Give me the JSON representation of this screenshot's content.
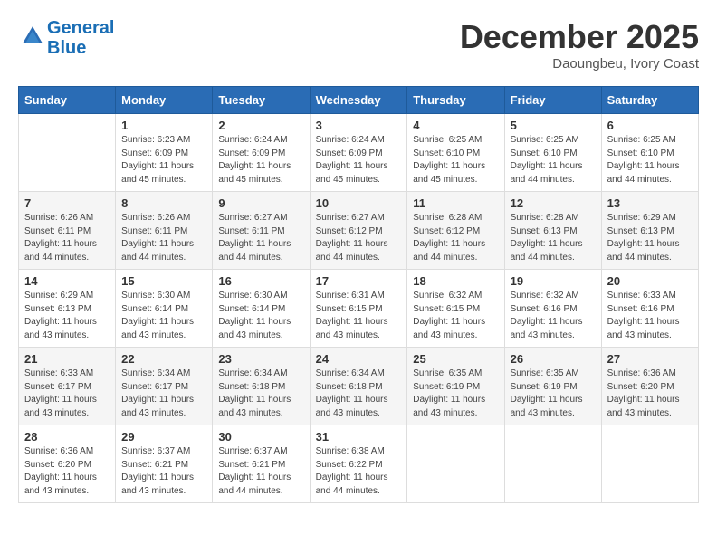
{
  "logo": {
    "line1": "General",
    "line2": "Blue"
  },
  "title": "December 2025",
  "location": "Daoungbeu, Ivory Coast",
  "weekdays": [
    "Sunday",
    "Monday",
    "Tuesday",
    "Wednesday",
    "Thursday",
    "Friday",
    "Saturday"
  ],
  "weeks": [
    [
      {
        "day": "",
        "info": ""
      },
      {
        "day": "1",
        "info": "Sunrise: 6:23 AM\nSunset: 6:09 PM\nDaylight: 11 hours\nand 45 minutes."
      },
      {
        "day": "2",
        "info": "Sunrise: 6:24 AM\nSunset: 6:09 PM\nDaylight: 11 hours\nand 45 minutes."
      },
      {
        "day": "3",
        "info": "Sunrise: 6:24 AM\nSunset: 6:09 PM\nDaylight: 11 hours\nand 45 minutes."
      },
      {
        "day": "4",
        "info": "Sunrise: 6:25 AM\nSunset: 6:10 PM\nDaylight: 11 hours\nand 45 minutes."
      },
      {
        "day": "5",
        "info": "Sunrise: 6:25 AM\nSunset: 6:10 PM\nDaylight: 11 hours\nand 44 minutes."
      },
      {
        "day": "6",
        "info": "Sunrise: 6:25 AM\nSunset: 6:10 PM\nDaylight: 11 hours\nand 44 minutes."
      }
    ],
    [
      {
        "day": "7",
        "info": "Sunrise: 6:26 AM\nSunset: 6:11 PM\nDaylight: 11 hours\nand 44 minutes."
      },
      {
        "day": "8",
        "info": "Sunrise: 6:26 AM\nSunset: 6:11 PM\nDaylight: 11 hours\nand 44 minutes."
      },
      {
        "day": "9",
        "info": "Sunrise: 6:27 AM\nSunset: 6:11 PM\nDaylight: 11 hours\nand 44 minutes."
      },
      {
        "day": "10",
        "info": "Sunrise: 6:27 AM\nSunset: 6:12 PM\nDaylight: 11 hours\nand 44 minutes."
      },
      {
        "day": "11",
        "info": "Sunrise: 6:28 AM\nSunset: 6:12 PM\nDaylight: 11 hours\nand 44 minutes."
      },
      {
        "day": "12",
        "info": "Sunrise: 6:28 AM\nSunset: 6:13 PM\nDaylight: 11 hours\nand 44 minutes."
      },
      {
        "day": "13",
        "info": "Sunrise: 6:29 AM\nSunset: 6:13 PM\nDaylight: 11 hours\nand 44 minutes."
      }
    ],
    [
      {
        "day": "14",
        "info": "Sunrise: 6:29 AM\nSunset: 6:13 PM\nDaylight: 11 hours\nand 43 minutes."
      },
      {
        "day": "15",
        "info": "Sunrise: 6:30 AM\nSunset: 6:14 PM\nDaylight: 11 hours\nand 43 minutes."
      },
      {
        "day": "16",
        "info": "Sunrise: 6:30 AM\nSunset: 6:14 PM\nDaylight: 11 hours\nand 43 minutes."
      },
      {
        "day": "17",
        "info": "Sunrise: 6:31 AM\nSunset: 6:15 PM\nDaylight: 11 hours\nand 43 minutes."
      },
      {
        "day": "18",
        "info": "Sunrise: 6:32 AM\nSunset: 6:15 PM\nDaylight: 11 hours\nand 43 minutes."
      },
      {
        "day": "19",
        "info": "Sunrise: 6:32 AM\nSunset: 6:16 PM\nDaylight: 11 hours\nand 43 minutes."
      },
      {
        "day": "20",
        "info": "Sunrise: 6:33 AM\nSunset: 6:16 PM\nDaylight: 11 hours\nand 43 minutes."
      }
    ],
    [
      {
        "day": "21",
        "info": "Sunrise: 6:33 AM\nSunset: 6:17 PM\nDaylight: 11 hours\nand 43 minutes."
      },
      {
        "day": "22",
        "info": "Sunrise: 6:34 AM\nSunset: 6:17 PM\nDaylight: 11 hours\nand 43 minutes."
      },
      {
        "day": "23",
        "info": "Sunrise: 6:34 AM\nSunset: 6:18 PM\nDaylight: 11 hours\nand 43 minutes."
      },
      {
        "day": "24",
        "info": "Sunrise: 6:34 AM\nSunset: 6:18 PM\nDaylight: 11 hours\nand 43 minutes."
      },
      {
        "day": "25",
        "info": "Sunrise: 6:35 AM\nSunset: 6:19 PM\nDaylight: 11 hours\nand 43 minutes."
      },
      {
        "day": "26",
        "info": "Sunrise: 6:35 AM\nSunset: 6:19 PM\nDaylight: 11 hours\nand 43 minutes."
      },
      {
        "day": "27",
        "info": "Sunrise: 6:36 AM\nSunset: 6:20 PM\nDaylight: 11 hours\nand 43 minutes."
      }
    ],
    [
      {
        "day": "28",
        "info": "Sunrise: 6:36 AM\nSunset: 6:20 PM\nDaylight: 11 hours\nand 43 minutes."
      },
      {
        "day": "29",
        "info": "Sunrise: 6:37 AM\nSunset: 6:21 PM\nDaylight: 11 hours\nand 43 minutes."
      },
      {
        "day": "30",
        "info": "Sunrise: 6:37 AM\nSunset: 6:21 PM\nDaylight: 11 hours\nand 44 minutes."
      },
      {
        "day": "31",
        "info": "Sunrise: 6:38 AM\nSunset: 6:22 PM\nDaylight: 11 hours\nand 44 minutes."
      },
      {
        "day": "",
        "info": ""
      },
      {
        "day": "",
        "info": ""
      },
      {
        "day": "",
        "info": ""
      }
    ]
  ]
}
